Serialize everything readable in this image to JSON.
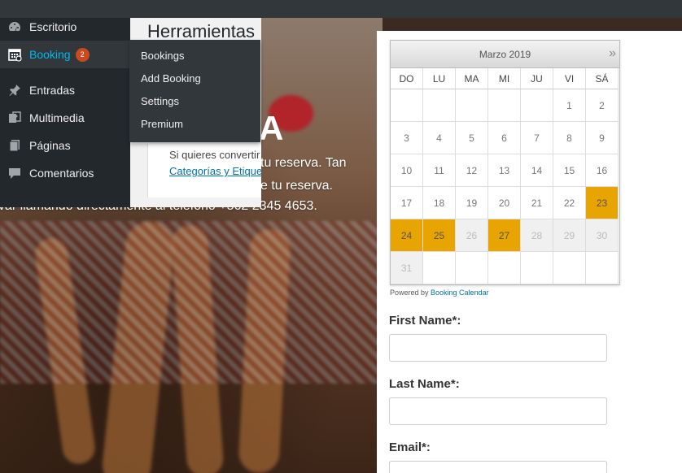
{
  "sidebar": {
    "items": [
      {
        "label": "Escritorio",
        "icon": "dashboard-icon"
      },
      {
        "label": "Booking",
        "icon": "calendar-icon",
        "badge": "2"
      },
      {
        "label": "Entradas",
        "icon": "pin-icon"
      },
      {
        "label": "Multimedia",
        "icon": "media-icon"
      },
      {
        "label": "Páginas",
        "icon": "pages-icon"
      },
      {
        "label": "Comentarios",
        "icon": "comment-icon"
      }
    ]
  },
  "submenu": {
    "items": [
      "Bookings",
      "Add Booking",
      "Settings",
      "Premium"
    ]
  },
  "panel": {
    "title": "Herramientas",
    "text": "Si quieres convertir",
    "link": "Categorías y Etiquet"
  },
  "hero": {
    "big": "A",
    "line1": "tu reserva. Tan",
    "line2": "e tu reserva.",
    "line3": "var llamando directamente al teléfono +562 2345 4653."
  },
  "calendar": {
    "title": "Marzo 2019",
    "next": "»",
    "weekdays": [
      "DO",
      "LU",
      "MA",
      "MI",
      "JU",
      "VI",
      "SÁ"
    ],
    "rows": [
      [
        "",
        "",
        "",
        "",
        "",
        "1",
        "2"
      ],
      [
        "3",
        "4",
        "5",
        "6",
        "7",
        "8",
        "9"
      ],
      [
        "10",
        "11",
        "12",
        "13",
        "14",
        "15",
        "16"
      ],
      [
        "17",
        "18",
        "19",
        "20",
        "21",
        "22",
        "23"
      ],
      [
        "24",
        "25",
        "26",
        "27",
        "28",
        "29",
        "30"
      ],
      [
        "31",
        "",
        "",
        "",
        "",
        "",
        ""
      ]
    ],
    "booked": [
      "23",
      "24",
      "25",
      "27"
    ],
    "past": [
      "26",
      "28",
      "29",
      "30",
      "31"
    ],
    "booked_color": "#e8a400"
  },
  "powered": {
    "prefix": "Powered by ",
    "link": "Booking Calendar"
  },
  "form": {
    "first_name": "First Name*:",
    "last_name": "Last Name*:",
    "email": "Email*:"
  }
}
